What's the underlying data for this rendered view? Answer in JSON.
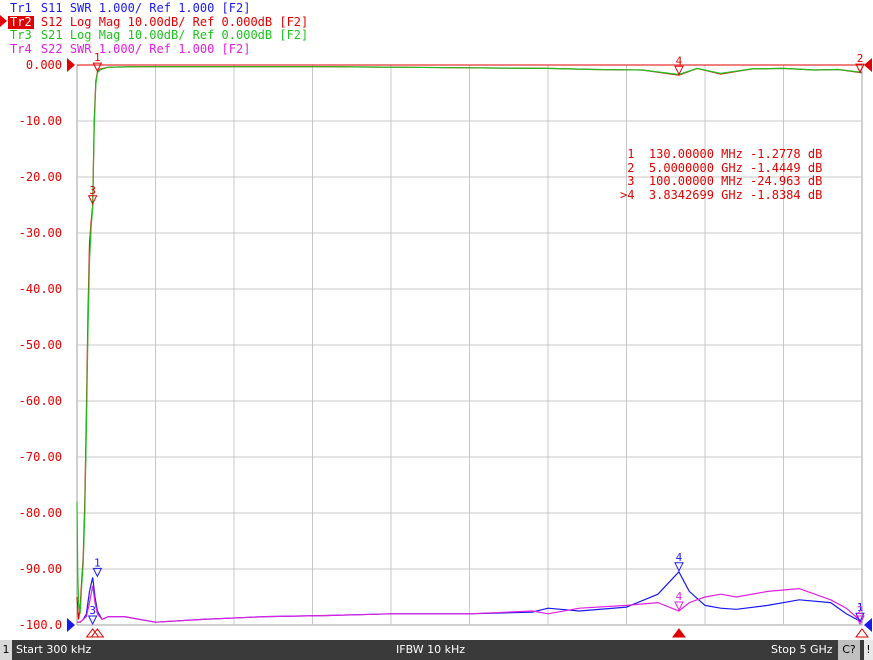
{
  "traces": [
    {
      "id": "Tr1",
      "param": "S11",
      "format": "SWR",
      "scale": "1.000/",
      "ref": "Ref 1.000",
      "tag": "[F2]",
      "color": "#1a1aee",
      "active": false
    },
    {
      "id": "Tr2",
      "param": "S12",
      "format": "Log Mag",
      "scale": "10.00dB/",
      "ref": "Ref 0.000dB",
      "tag": "[F2]",
      "color": "#e00000",
      "active": true
    },
    {
      "id": "Tr3",
      "param": "S21",
      "format": "Log Mag",
      "scale": "10.00dB/",
      "ref": "Ref 0.000dB",
      "tag": "[F2]",
      "color": "#20c020",
      "active": false
    },
    {
      "id": "Tr4",
      "param": "S22",
      "format": "SWR",
      "scale": "1.000/",
      "ref": "Ref 1.000",
      "tag": "[F2]",
      "color": "#e020e0",
      "active": false
    }
  ],
  "marker_table": [
    {
      "sel": " ",
      "num": "1",
      "stim": "130.00000 MHz",
      "resp": "-1.2778 dB"
    },
    {
      "sel": " ",
      "num": "2",
      "stim": "5.0000000 GHz",
      "resp": "-1.4449 dB"
    },
    {
      "sel": " ",
      "num": "3",
      "stim": "100.00000 MHz",
      "resp": "-24.963 dB"
    },
    {
      "sel": ">",
      "num": "4",
      "stim": "3.8342699 GHz",
      "resp": "-1.8384 dB"
    }
  ],
  "status": {
    "channel": "1",
    "start": "Start 300 kHz",
    "ifbw": "IFBW 10 kHz",
    "stop": "Stop 5 GHz",
    "cal": "C?",
    "warn": "!"
  },
  "chart_data": {
    "type": "line",
    "x_unit": "MHz",
    "xlim": [
      0.3,
      5000
    ],
    "ylim": [
      -100,
      0
    ],
    "y_ticks": [
      "0.000",
      "-10.00",
      "-20.00",
      "-30.00",
      "-40.00",
      "-50.00",
      "-60.00",
      "-70.00",
      "-80.00",
      "-90.00",
      "-100.0"
    ],
    "x_divisions": 10,
    "grid": true,
    "series": [
      {
        "name": "Tr2 S12",
        "color": "#e00000",
        "x": [
          0.3,
          10,
          20,
          30,
          40,
          50,
          60,
          70,
          80,
          90,
          100,
          110,
          120,
          130,
          150,
          200,
          400,
          800,
          1200,
          1600,
          2000,
          2500,
          3000,
          3300,
          3600,
          3834,
          3950,
          4100,
          4300,
          4500,
          4700,
          4850,
          5000
        ],
        "y": [
          -95,
          -99,
          -97,
          -92,
          -88,
          -78,
          -62,
          -45,
          -32,
          -28,
          -25,
          -10,
          -3,
          -1.3,
          -0.7,
          -0.4,
          -0.3,
          -0.3,
          -0.3,
          -0.3,
          -0.4,
          -0.5,
          -0.6,
          -0.8,
          -0.9,
          -1.8,
          -0.6,
          -1.6,
          -0.7,
          -0.6,
          -0.9,
          -0.8,
          -1.4
        ]
      },
      {
        "name": "Tr3 S21",
        "color": "#20c020",
        "x": [
          0.3,
          5,
          10,
          20,
          30,
          40,
          50,
          60,
          70,
          80,
          90,
          100,
          110,
          120,
          130,
          150,
          200,
          400,
          800,
          1200,
          1600,
          2000,
          2500,
          3000,
          3300,
          3600,
          3834,
          3950,
          4100,
          4300,
          4500,
          4700,
          4850,
          5000
        ],
        "y": [
          -78,
          -90,
          -96,
          -98,
          -93,
          -89,
          -80,
          -65,
          -48,
          -35,
          -29,
          -25.5,
          -11,
          -3.5,
          -1.4,
          -0.8,
          -0.4,
          -0.3,
          -0.3,
          -0.3,
          -0.3,
          -0.4,
          -0.5,
          -0.6,
          -0.8,
          -0.9,
          -1.7,
          -0.6,
          -1.5,
          -0.7,
          -0.6,
          -0.9,
          -0.8,
          -1.3
        ]
      },
      {
        "name": "Tr1 S11",
        "color": "#1a1aee",
        "x": [
          0.3,
          20,
          40,
          60,
          80,
          100,
          115,
          130,
          160,
          200,
          300,
          500,
          800,
          1200,
          1600,
          2000,
          2500,
          2900,
          3000,
          3200,
          3500,
          3700,
          3834,
          3900,
          4000,
          4100,
          4200,
          4400,
          4600,
          4800,
          4900,
          5000
        ],
        "y": [
          -99.5,
          -99.5,
          -99,
          -98,
          -94,
          -91.5,
          -95,
          -97.5,
          -99,
          -98.5,
          -98.5,
          -99.5,
          -99,
          -98.5,
          -98.3,
          -98,
          -98,
          -97.7,
          -97,
          -97.5,
          -96.8,
          -94.5,
          -90.5,
          -94,
          -96.5,
          -97,
          -97.2,
          -96.5,
          -95.5,
          -96,
          -98,
          -99.5
        ]
      },
      {
        "name": "Tr4 S22",
        "color": "#e020e0",
        "x": [
          0.3,
          20,
          40,
          60,
          80,
          100,
          115,
          130,
          160,
          200,
          300,
          500,
          800,
          1200,
          1600,
          2000,
          2500,
          2900,
          3000,
          3200,
          3500,
          3700,
          3834,
          3900,
          4000,
          4100,
          4200,
          4400,
          4600,
          4800,
          4900,
          5000
        ],
        "y": [
          -99.5,
          -99.5,
          -99,
          -98.5,
          -96,
          -93,
          -96,
          -98,
          -99,
          -98.5,
          -98.5,
          -99.5,
          -99,
          -98.5,
          -98.3,
          -98,
          -98,
          -97.5,
          -98,
          -97,
          -96.5,
          -96,
          -97.5,
          -96,
          -95,
          -94.5,
          -95,
          -94,
          -93.5,
          -95.5,
          -97,
          -99.5
        ]
      }
    ],
    "markers": [
      {
        "label": "1",
        "x": 130,
        "y": -1.2778,
        "trace": "Tr2"
      },
      {
        "label": "2",
        "x": 5000,
        "y": -1.4449,
        "trace": "Tr2"
      },
      {
        "label": "3",
        "x": 100,
        "y": -24.963,
        "trace": "Tr2"
      },
      {
        "label": "4",
        "x": 3834.2699,
        "y": -1.8384,
        "trace": "Tr2"
      },
      {
        "label": "1",
        "x": 130,
        "y": -91.5,
        "trace": "Tr1"
      },
      {
        "label": "3",
        "x": 100,
        "y": -100,
        "trace": "Tr1"
      },
      {
        "label": "4",
        "x": 3834.2699,
        "y": -90.5,
        "trace": "Tr1"
      },
      {
        "label": "1",
        "x": 5000,
        "y": -99.5,
        "trace": "Tr1"
      },
      {
        "label": "4",
        "x": 3834.2699,
        "y": -97.5,
        "trace": "Tr4"
      },
      {
        "label": "2",
        "x": 5000,
        "y": -100,
        "trace": "Tr4"
      }
    ]
  }
}
